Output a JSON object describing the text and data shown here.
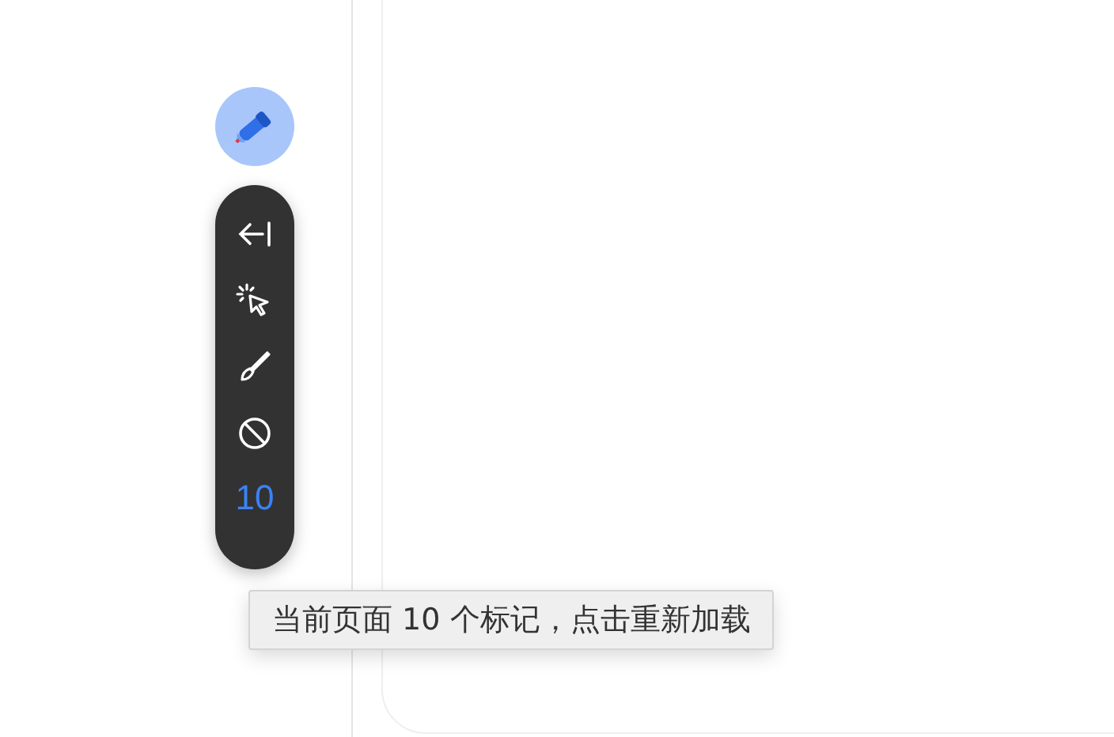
{
  "toolbar": {
    "tools": [
      {
        "kind": "collapse"
      },
      {
        "kind": "pick"
      },
      {
        "kind": "brush"
      },
      {
        "kind": "block"
      }
    ],
    "count": "10"
  },
  "tooltip": {
    "text": "当前页面 10 个标记，点击重新加载"
  }
}
